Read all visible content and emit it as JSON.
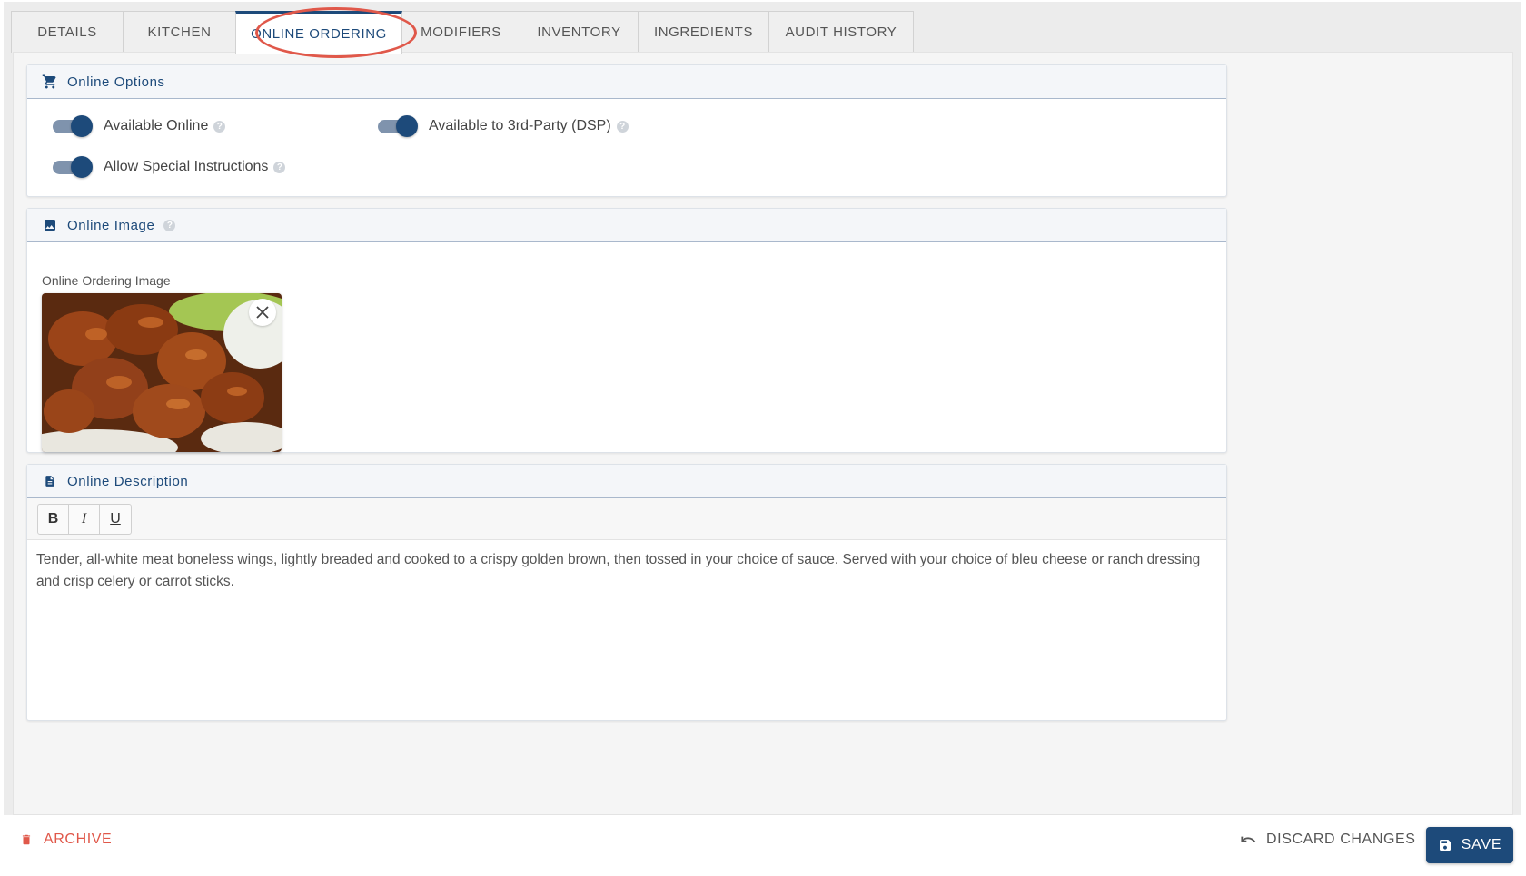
{
  "tabs": [
    {
      "label": "DETAILS",
      "active": false
    },
    {
      "label": "KITCHEN",
      "active": false
    },
    {
      "label": "ONLINE ORDERING",
      "active": true
    },
    {
      "label": "MODIFIERS",
      "active": false
    },
    {
      "label": "INVENTORY",
      "active": false
    },
    {
      "label": "INGREDIENTS",
      "active": false
    },
    {
      "label": "AUDIT HISTORY",
      "active": false
    }
  ],
  "online_options": {
    "title": "Online Options",
    "available_online": {
      "label": "Available Online",
      "checked": true
    },
    "available_3rd_party": {
      "label": "Available to 3rd-Party (DSP)",
      "checked": true
    },
    "allow_special_instructions": {
      "label": "Allow Special Instructions",
      "checked": true
    }
  },
  "online_image": {
    "title": "Online Image",
    "field_label": "Online Ordering Image"
  },
  "online_description": {
    "title": "Online Description",
    "toolbar": {
      "bold": "B",
      "italic": "I",
      "underline": "U"
    },
    "text": "Tender, all-white meat boneless wings, lightly breaded and cooked to a crispy golden brown, then tossed in your choice of  sauce. Served with your choice of bleu cheese or ranch dressing and crisp celery or carrot sticks."
  },
  "footer": {
    "archive_label": "ARCHIVE",
    "discard_label": "DISCARD CHANGES",
    "save_label": "SAVE"
  },
  "colors": {
    "accent": "#1d4a7a",
    "danger": "#e0584a",
    "highlight_ring": "#e0584a"
  }
}
